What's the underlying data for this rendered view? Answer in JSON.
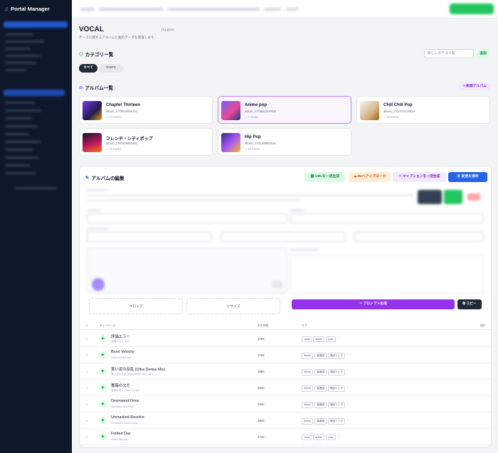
{
  "app": {
    "brand": "Portal Manager"
  },
  "header": {
    "title": "VOCAL",
    "filename": "(01.json)",
    "description": "テーマに関するアルバムと曲のデータを管理します。"
  },
  "categories": {
    "heading": "カテゴリー覧",
    "input_placeholder": "新しいカテゴリ名",
    "add_label": "追加",
    "filters": [
      "すべて",
      "POPS"
    ]
  },
  "albums": {
    "heading": "アルバム一覧",
    "new_label": "+ 新規アルバム",
    "items": [
      {
        "title": "Chapter Thirteen",
        "id": "album_1778034866742",
        "tracks": "♫ 13 tracks",
        "selected": false
      },
      {
        "title": "Anime pop",
        "id": "album_1778851387685",
        "tracks": "♫ 7 tracks",
        "selected": true
      },
      {
        "title": "Chill Chill Pop",
        "id": "album_1781378120818",
        "tracks": "♫ 10 tracks",
        "selected": false
      },
      {
        "title": "フレンチ・シティポップ",
        "id": "album_1782245981482",
        "tracks": "♫ 15 tracks",
        "selected": false
      },
      {
        "title": "Hip Pop",
        "id": "album_1781359854041",
        "tracks": "♫ 10 tracks",
        "selected": false
      }
    ]
  },
  "editor": {
    "heading": "アルバムの編集",
    "actions": {
      "url_batch": "URLを一括生成",
      "r2_upload": "R2へアップロード",
      "caption_batch": "キャプションを一括生成",
      "save": "変更を保存"
    },
    "crop_label": "クロップ",
    "resize_label": "リサイズ",
    "generate_prompt": "プロンプト生成",
    "copy_label": "コピー"
  },
  "tracks_table": {
    "columns": [
      "#",
      "タイトル / ID",
      "再生時間",
      "タグ",
      "操作"
    ],
    "rows": [
      {
        "no": "1",
        "title": "評価エラー",
        "file": "評価エラー.mp3",
        "duration": "178s",
        "tags": [
          "vocal",
          "anime",
          "pops"
        ]
      },
      {
        "no": "2",
        "title": "Burst Velocity",
        "file": "burst velocity.mp3",
        "duration": "175s",
        "tags": [
          "Anime",
          "高揚感",
          "電波ソング"
        ]
      },
      {
        "no": "3",
        "title": "黄い泥の反乱 (Ultra Denpa Mix)",
        "file": "黄い泥の反乱 (Ultra Denpa Mix).mp3",
        "duration": "198s",
        "tags": [
          "Anime",
          "高揚感",
          "電波ソング"
        ]
      },
      {
        "no": "4",
        "title": "薔薇の欠片",
        "file": "薔薇の欠片 (Take 1).mp3",
        "duration": "184s",
        "tags": [
          "Anime",
          "高揚感",
          "電波ソング"
        ]
      },
      {
        "no": "5",
        "title": "Downward Drive",
        "file": "downward drive.mp3",
        "duration": "164s",
        "tags": [
          "Anime",
          "高揚感",
          "電波ソング"
        ]
      },
      {
        "no": "6",
        "title": "Unmasked Resolve",
        "file": "unmasked resolve.mp3",
        "duration": "182s",
        "tags": [
          "Anime",
          "高揚感",
          "電波ソング"
        ]
      },
      {
        "no": "7",
        "title": "Folded Day",
        "file": "folded day.mp3",
        "duration": "174s",
        "tags": [
          "vocal",
          "anime",
          "pops"
        ]
      }
    ]
  },
  "colors": {
    "sidebar": "#0f172a",
    "accent_green": "#22c55e",
    "accent_purple": "#9333ea",
    "accent_blue": "#2563eb"
  }
}
